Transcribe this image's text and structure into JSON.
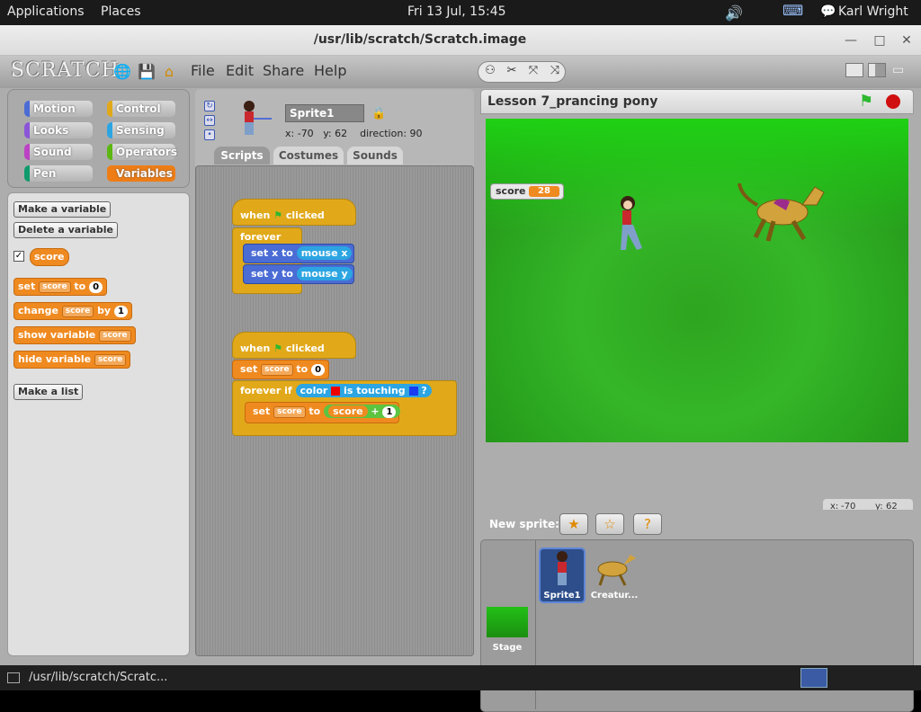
{
  "top_panel": {
    "applications": "Applications",
    "places": "Places",
    "clock": "Fri 13 Jul, 15:45",
    "user": "Karl Wright"
  },
  "window": {
    "title": "/usr/lib/scratch/Scratch.image"
  },
  "menubar": {
    "logo": "SCRATCH",
    "items": [
      "File",
      "Edit",
      "Share",
      "Help"
    ]
  },
  "categories": [
    {
      "label": "Motion",
      "color": "#4a6cd4"
    },
    {
      "label": "Control",
      "color": "#e1a91a"
    },
    {
      "label": "Looks",
      "color": "#8a55d7"
    },
    {
      "label": "Sensing",
      "color": "#2ca5e2"
    },
    {
      "label": "Sound",
      "color": "#bb42c3"
    },
    {
      "label": "Operators",
      "color": "#5cb712"
    },
    {
      "label": "Pen",
      "color": "#0e9a6c"
    },
    {
      "label": "Variables",
      "color": "#ee7d16"
    }
  ],
  "palette": {
    "make_variable": "Make a variable",
    "delete_variable": "Delete a variable",
    "score_var": "score",
    "set_label": "set",
    "to_label": "to",
    "change_label": "change",
    "by_label": "by",
    "show_variable": "show variable",
    "hide_variable": "hide variable",
    "dropdown_value": "score",
    "set_value": "0",
    "change_value": "1",
    "make_list": "Make a list"
  },
  "sprite": {
    "name": "Sprite1",
    "x_label": "x:",
    "x": "-70",
    "y_label": "y:",
    "y": "62",
    "direction_label": "direction:",
    "direction": "90"
  },
  "tabs": [
    "Scripts",
    "Costumes",
    "Sounds"
  ],
  "scripts": {
    "when_label": "when",
    "clicked_label": "clicked",
    "forever_label": "forever",
    "set_x": "set x to",
    "set_y": "set y to",
    "mouse_x": "mouse x",
    "mouse_y": "mouse y",
    "set_label": "set",
    "to_label": "to",
    "score": "score",
    "zero": "0",
    "forever_if": "forever if",
    "color_label": "color",
    "is_touching": "is touching",
    "question": "?",
    "plus": "+",
    "one": "1"
  },
  "stage": {
    "title": "Lesson 7_prancing pony",
    "score_label": "score",
    "score_value": "28",
    "mouse_x_label": "x:",
    "mouse_x": "-70",
    "mouse_y_label": "y:",
    "mouse_y": "62"
  },
  "sprites_panel": {
    "new_sprite": "New sprite:",
    "sprites": [
      "Sprite1",
      "Creatur..."
    ],
    "stage_label": "Stage"
  },
  "taskbar": {
    "task": "/usr/lib/scratch/Scratc..."
  }
}
